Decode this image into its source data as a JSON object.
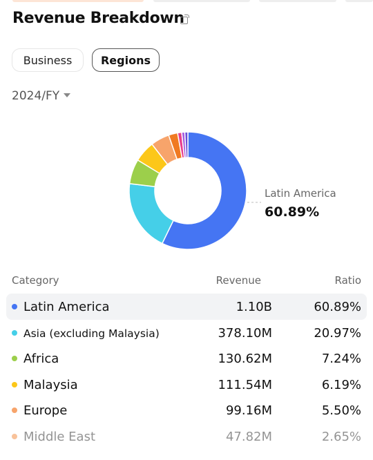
{
  "header": {
    "title": "Revenue Breakdown",
    "share_icon": "share-icon"
  },
  "tabs": [
    {
      "label": "Business",
      "active": false
    },
    {
      "label": "Regions",
      "active": true
    }
  ],
  "period": {
    "value": "2024/FY"
  },
  "chart_data": {
    "type": "pie",
    "donut": true,
    "highlight": {
      "label": "Latin America",
      "value": "60.89%"
    },
    "columns": [
      "Category",
      "Revenue",
      "Ratio"
    ],
    "rows": [
      {
        "category": "Latin America",
        "revenue": "1.10B",
        "ratio": "60.89%",
        "value": 60.89,
        "color": "#4575f3"
      },
      {
        "category": "Asia (excluding Malaysia)",
        "revenue": "378.10M",
        "ratio": "20.97%",
        "value": 20.97,
        "color": "#45cfe8"
      },
      {
        "category": "Africa",
        "revenue": "130.62M",
        "ratio": "7.24%",
        "value": 7.24,
        "color": "#9ccf4b"
      },
      {
        "category": "Malaysia",
        "revenue": "111.54M",
        "ratio": "6.19%",
        "value": 6.19,
        "color": "#fcc719"
      },
      {
        "category": "Europe",
        "revenue": "99.16M",
        "ratio": "5.50%",
        "value": 5.5,
        "color": "#f7a46b"
      },
      {
        "category": "Middle East",
        "revenue": "47.82M",
        "ratio": "2.65%",
        "value": 2.65,
        "color": "#f07a22"
      }
    ]
  }
}
